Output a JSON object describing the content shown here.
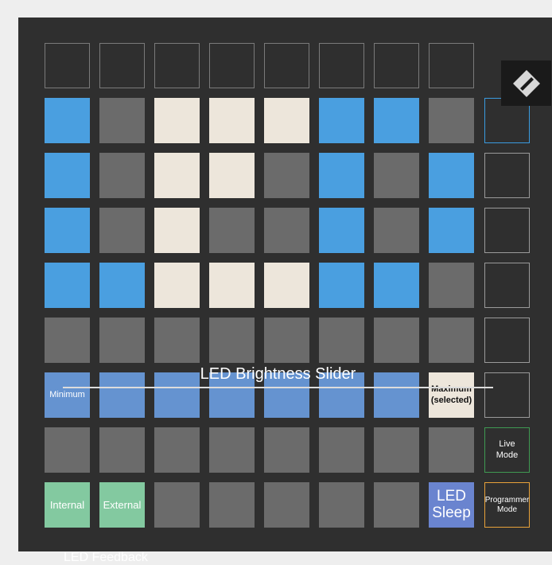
{
  "slider": {
    "caption": "LED Brightness Slider",
    "min_label": "Minimum",
    "max_label_line1": "Maximum",
    "max_label_line2": "(selected)"
  },
  "feedback": {
    "caption": "LED Feedback",
    "internal_label": "Internal",
    "external_label": "External"
  },
  "sleep": {
    "line1": "LED",
    "line2": "Sleep"
  },
  "modes": {
    "live_line1": "Live",
    "live_line2": "Mode",
    "programmer_line1": "Programmer",
    "programmer_line2": "Mode"
  },
  "logo": {
    "icon": "novation-logo-icon"
  },
  "colors": {
    "blue": "#4a9fe0",
    "slider_blue": "#6593d0",
    "white": "#ede6db",
    "green": "#83c9a0",
    "gray": "#6b6b6b",
    "live_border": "#3f9a52",
    "programmer_border": "#e8a23a",
    "session_border": "#3a9be0"
  }
}
